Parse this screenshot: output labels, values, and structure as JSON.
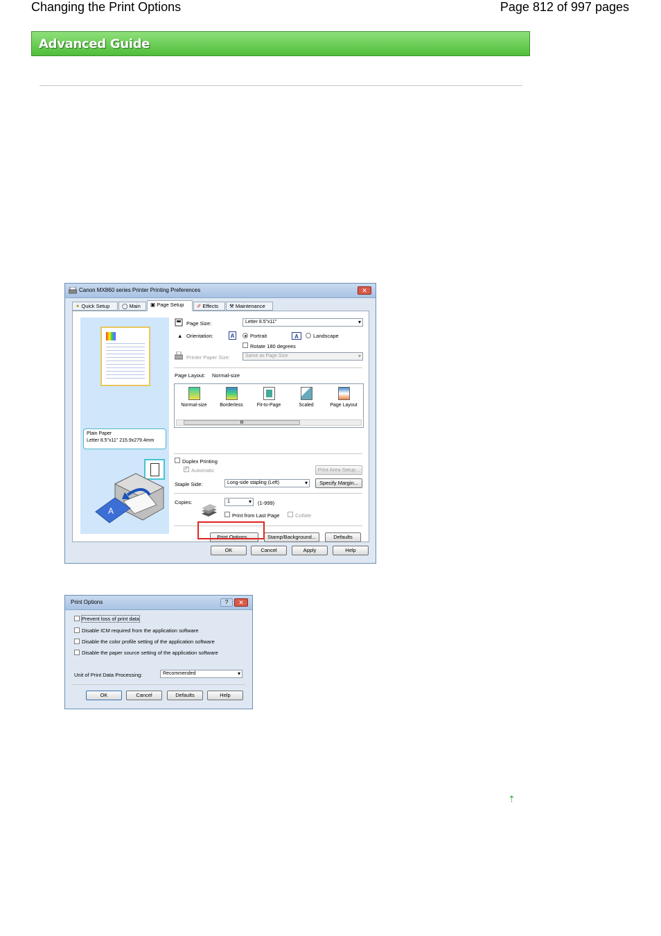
{
  "header": {
    "title": "Changing the Print Options",
    "page_info": "Page 812 of 997 pages"
  },
  "banner": {
    "label": "Advanced Guide"
  },
  "dialog1": {
    "title": "Canon MX860 series Printer Printing Preferences",
    "close": "✕",
    "tabs": [
      "Quick Setup",
      "Main",
      "Page Setup",
      "Effects",
      "Maintenance"
    ],
    "active_tab": "Page Setup",
    "page_size_label": "Page Size:",
    "page_size_value": "Letter 8.5\"x11\"",
    "orientation_label": "Orientation:",
    "portrait": "Portrait",
    "landscape": "Landscape",
    "rotate": "Rotate 180 degrees",
    "printer_paper_size_label": "Printer Paper Size:",
    "printer_paper_size_value": "Same as Page Size",
    "page_layout_label": "Page Layout:",
    "page_layout_value": "Normal-size",
    "layouts": [
      "Normal-size",
      "Borderless",
      "Fit-to-Page",
      "Scaled",
      "Page Layout"
    ],
    "scroll_thumb": "III",
    "media_line1": "Plain Paper",
    "media_line2": "Letter 8.5\"x11\" 215.9x279.4mm",
    "duplex": "Duplex Printing",
    "automatic": "Automatic",
    "print_area_setup": "Print Area Setup...",
    "staple_side_label": "Staple Side:",
    "staple_side_value": "Long-side stapling (Left)",
    "specify_margin": "Specify Margin...",
    "copies_label": "Copies:",
    "copies_value": "1",
    "copies_range": "(1-999)",
    "print_from_last": "Print from Last Page",
    "collate": "Collate",
    "print_options": "Print Options...",
    "stamp_background": "Stamp/Background...",
    "defaults": "Defaults",
    "ok": "OK",
    "cancel": "Cancel",
    "apply": "Apply",
    "help": "Help"
  },
  "dialog2": {
    "title": "Print Options",
    "help_btn": "?",
    "close": "✕",
    "options": [
      "Prevent loss of print data",
      "Disable ICM required from the application software",
      "Disable the color profile setting of the application software",
      "Disable the paper source setting of the application software"
    ],
    "unit_label": "Unit of Print Data Processing:",
    "unit_value": "Recommended",
    "ok": "OK",
    "cancel": "Cancel",
    "defaults": "Defaults",
    "help": "Help"
  },
  "page_top_icon": "⇡",
  "colors": {
    "banner_green": "#4fbd3a",
    "highlight_red": "#e02424"
  }
}
